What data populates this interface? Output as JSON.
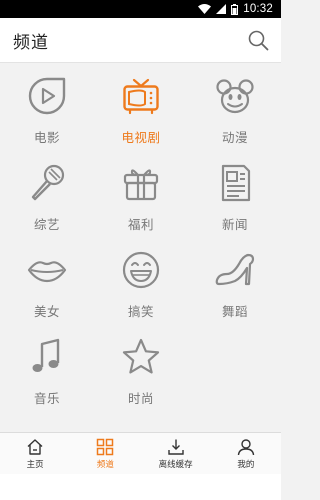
{
  "status_bar": {
    "time": "10:32"
  },
  "header": {
    "title": "频道",
    "search_icon": "search-icon"
  },
  "colors": {
    "accent": "#ee7a1c",
    "icon_gray": "#8a8a8a"
  },
  "channels": [
    {
      "label": "电影",
      "icon": "play-circle-icon",
      "active": false
    },
    {
      "label": "电视剧",
      "icon": "tv-icon",
      "active": true
    },
    {
      "label": "动漫",
      "icon": "mouse-head-icon",
      "active": false
    },
    {
      "label": "综艺",
      "icon": "microphone-icon",
      "active": false
    },
    {
      "label": "福利",
      "icon": "gift-icon",
      "active": false
    },
    {
      "label": "新闻",
      "icon": "newspaper-icon",
      "active": false
    },
    {
      "label": "美女",
      "icon": "lips-icon",
      "active": false
    },
    {
      "label": "搞笑",
      "icon": "smiley-icon",
      "active": false
    },
    {
      "label": "舞蹈",
      "icon": "high-heel-icon",
      "active": false
    },
    {
      "label": "音乐",
      "icon": "music-note-icon",
      "active": false
    },
    {
      "label": "时尚",
      "icon": "star-icon",
      "active": false
    }
  ],
  "bottom_nav": [
    {
      "label": "主页",
      "icon": "home-icon",
      "active": false
    },
    {
      "label": "频道",
      "icon": "grid-icon",
      "active": true
    },
    {
      "label": "离线缓存",
      "icon": "download-icon",
      "active": false
    },
    {
      "label": "我的",
      "icon": "user-icon",
      "active": false
    }
  ]
}
